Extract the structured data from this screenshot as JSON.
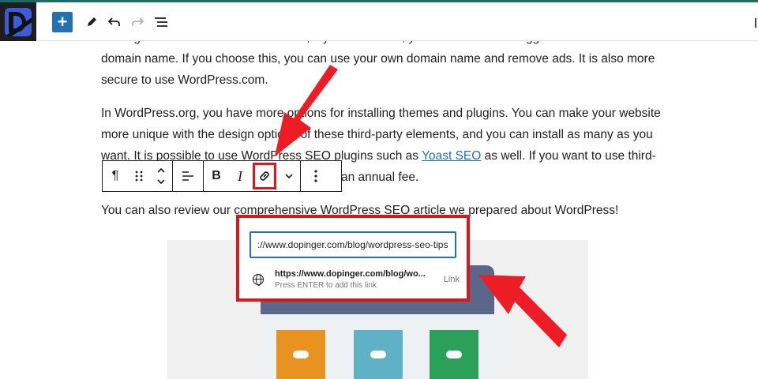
{
  "editor": {
    "add_block_label": "+",
    "accent_color": "#2271b1",
    "topbar_accent": "#1e6b63",
    "icons": [
      "logo-icon",
      "plus-icon",
      "pencil-icon",
      "undo-icon",
      "redo-icon",
      "list-view-icon"
    ]
  },
  "article": {
    "cut_line": "hosting and a domain name. However, if you use it.com, you don't need to struggle with a web host or",
    "p1_line2": "domain name. If you choose this, you can use your own domain name and remove ads. It is also more",
    "p1_line3": "secure to use WordPress.com.",
    "p2_line1": "In WordPress.org, you have more options for installing themes and plugins. You can make your website",
    "p2_line2": "more unique with the design options of these third-party elements, and you can install as many as you",
    "p2_line3_pre": "want. It is possible to use WordPress SEO plugins such as",
    "p2_line3_link": "Yoast SEO",
    "p2_line3_post": "as well. If you want to use third-",
    "p2_line4_tail": "an annual fee.",
    "p3_line1": "You can also review our comprehensive WordPress SEO article we prepared about WordPress!"
  },
  "block_toolbar": {
    "paragraph": "¶",
    "bold": "B",
    "italic": "I",
    "icons": [
      "paragraph-icon",
      "drag-handle-icon",
      "move-up-down-icon",
      "align-icon",
      "bold-icon",
      "italic-icon",
      "link-icon",
      "chevron-down-icon",
      "more-options-icon"
    ]
  },
  "link_popover": {
    "input_value": "://www.dopinger.com/blog/wordpress-seo-tips",
    "suggestion_url": "https://www.dopinger.com/blog/wo...",
    "suggestion_hint": "Press ENTER to add this link",
    "suggestion_type": "Link",
    "highlight_color": "#e1141c"
  }
}
